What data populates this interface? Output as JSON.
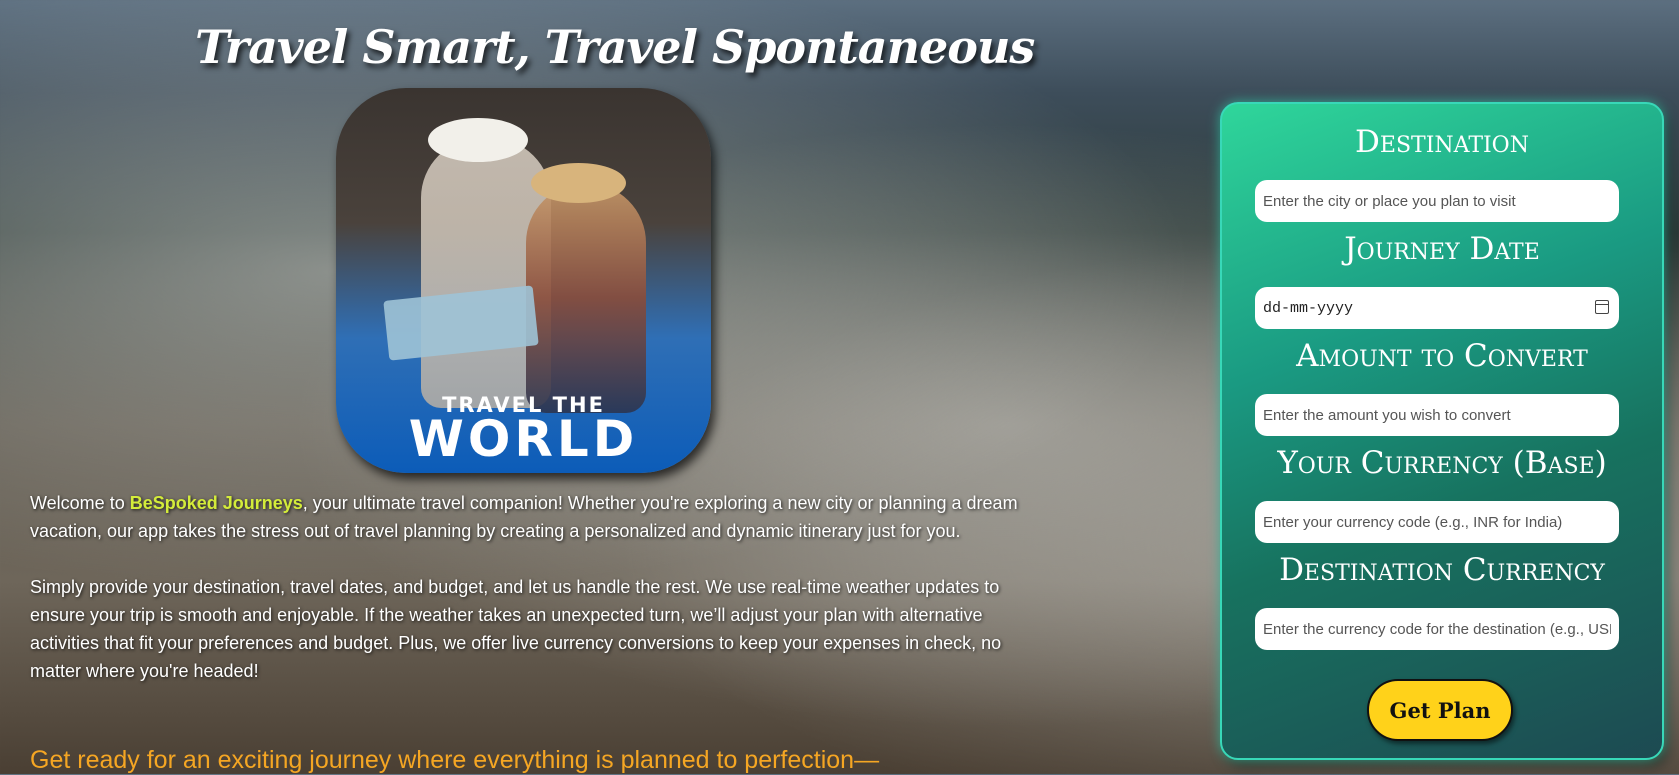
{
  "hero": {
    "title": "Travel Smart, Travel Spontaneous"
  },
  "poster": {
    "line1": "TRAVEL THE",
    "line2": "WORLD"
  },
  "intro": {
    "p1_start": "Welcome to ",
    "brand": "BeSpoked Journeys",
    "p1_end": ", your ultimate travel companion! Whether you're exploring a new city or planning a dream vacation, our app takes the stress out of travel planning by creating a personalized and dynamic itinerary just for you.",
    "p2": "Simply provide your destination, travel dates, and budget, and let us handle the rest. We use real-time weather updates to ensure your trip is smooth and enjoyable. If the weather takes an unexpected turn, we’ll adjust your plan with alternative activities that fit your preferences and budget. Plus, we offer live currency conversions to keep your expenses in check, no matter where you're headed!",
    "tagline": "Get ready for an exciting journey where everything is planned to perfection—"
  },
  "form": {
    "destination": {
      "label": "Destination",
      "placeholder": "Enter the city or place you plan to visit"
    },
    "journey_date": {
      "label": "Journey Date",
      "value": "dd-mm-yyyy"
    },
    "amount": {
      "label": "Amount to Convert",
      "placeholder": "Enter the amount you wish to convert"
    },
    "base_currency": {
      "label": "Your Currency (Base)",
      "placeholder": "Enter your currency code (e.g., INR for India)"
    },
    "dest_currency": {
      "label": "Destination Currency",
      "placeholder": "Enter the currency code for the destination (e.g., USD fo"
    },
    "submit_label": "Get Plan"
  }
}
